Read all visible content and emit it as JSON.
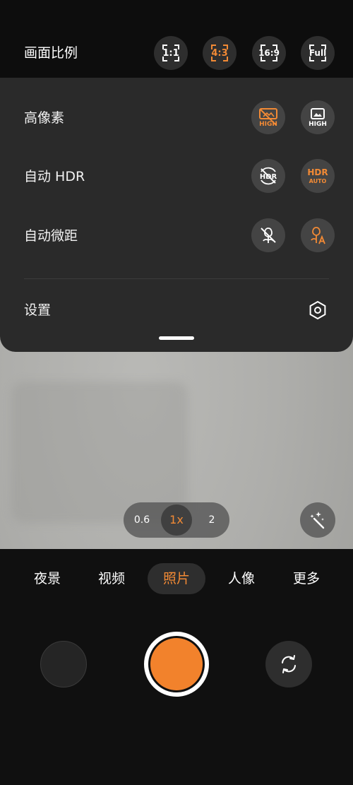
{
  "colors": {
    "accent": "#f28a35",
    "shutter": "#f2822c"
  },
  "top_bar": {
    "title": "画面比例",
    "ratios": [
      {
        "label": "1:1",
        "active": false
      },
      {
        "label": "4:3",
        "active": true
      },
      {
        "label": "16:9",
        "active": false
      },
      {
        "label": "Full",
        "active": false
      }
    ]
  },
  "settings": {
    "high_pixel": {
      "label": "高像素",
      "off_icon": "high-off-icon",
      "on_icon": "high-on-icon",
      "off_text": "HIGH",
      "on_text": "HIGH"
    },
    "auto_hdr": {
      "label": "自动 HDR",
      "off_icon": "hdr-off-icon",
      "on_icon": "hdr-auto-icon",
      "off_text": "HDR",
      "on_text_top": "HDR",
      "on_text_bottom": "AUTO"
    },
    "auto_macro": {
      "label": "自动微距",
      "off_icon": "macro-off-icon",
      "on_icon": "macro-auto-icon"
    },
    "settings_row": {
      "label": "设置",
      "icon": "gear-icon"
    }
  },
  "zoom": {
    "options": [
      "0.6",
      "1x",
      "2"
    ],
    "active": "1x"
  },
  "modes": [
    {
      "label": "夜景",
      "active": false
    },
    {
      "label": "视频",
      "active": false
    },
    {
      "label": "照片",
      "active": true
    },
    {
      "label": "人像",
      "active": false
    },
    {
      "label": "更多",
      "active": false
    }
  ],
  "controls": {
    "gallery_icon": "gallery-thumbnail",
    "shutter_icon": "shutter-button",
    "flip_icon": "switch-camera-icon",
    "magic_icon": "magic-wand-icon"
  }
}
